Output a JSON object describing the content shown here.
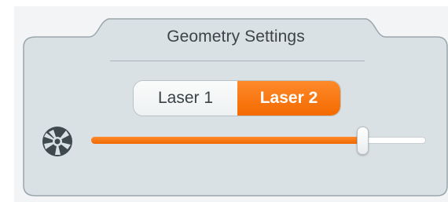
{
  "panel": {
    "title": "Geometry Settings"
  },
  "laser_selector": {
    "options": [
      "Laser 1",
      "Laser 2"
    ],
    "selected": "Laser 2"
  },
  "slider": {
    "value_fraction": 0.81,
    "accent_color": "#f36a00",
    "icon": "aperture-icon"
  },
  "colors": {
    "panel_background": "#d9e1e4",
    "panel_border": "#9aa6ab",
    "accent": "#f36a00",
    "icon": "#3f4a4f"
  }
}
